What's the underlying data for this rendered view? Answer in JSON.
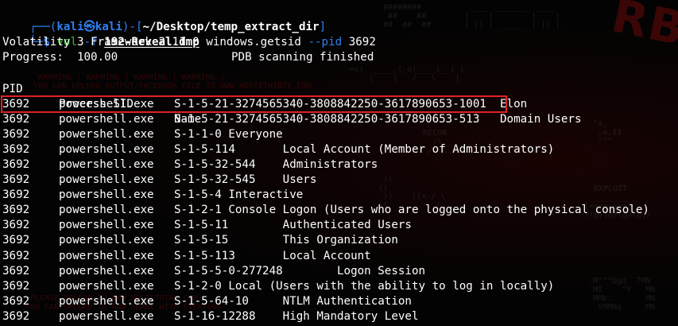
{
  "prompt": {
    "frame_top": "┌──(",
    "user": "kali㉿kali",
    "frame_mid": ")-[",
    "path": "~/Desktop/temp_extract_dir",
    "frame_end": "]",
    "frame_bottom": "└─",
    "sign": "$"
  },
  "command": {
    "name": "vol",
    "flag_f": "-f",
    "file": "192-Reveal.dmp",
    "plugin": "windows.getsid",
    "flag_pid": "--pid",
    "pid": "3692"
  },
  "output": {
    "banner": "Volatility 3 Framework 2.11.0",
    "progress": "Progress:  100.00\t\t       PDB scanning finished",
    "headers": {
      "pid": "PID",
      "process": "Process",
      "sid": "SID",
      "name": "Name"
    },
    "rows": [
      {
        "pid": "3692",
        "process": "powershell.exe",
        "rest": "S-1-5-21-3274565340-3808842250-3617890653-1001  Elon"
      },
      {
        "pid": "3692",
        "process": "powershell.exe",
        "rest": "S-1-5-21-3274565340-3808842250-3617890653-513   Domain Users"
      },
      {
        "pid": "3692",
        "process": "powershell.exe",
        "rest": "S-1-1-0 Everyone"
      },
      {
        "pid": "3692",
        "process": "powershell.exe",
        "rest": "S-1-5-114       Local Account (Member of Administrators)"
      },
      {
        "pid": "3692",
        "process": "powershell.exe",
        "rest": "S-1-5-32-544    Administrators"
      },
      {
        "pid": "3692",
        "process": "powershell.exe",
        "rest": "S-1-5-32-545    Users"
      },
      {
        "pid": "3692",
        "process": "powershell.exe",
        "rest": "S-1-5-4 Interactive"
      },
      {
        "pid": "3692",
        "process": "powershell.exe",
        "rest": "S-1-2-1 Console Logon (Users who are logged onto the physical console)"
      },
      {
        "pid": "3692",
        "process": "powershell.exe",
        "rest": "S-1-5-11        Authenticated Users"
      },
      {
        "pid": "3692",
        "process": "powershell.exe",
        "rest": "S-1-5-15        This Organization"
      },
      {
        "pid": "3692",
        "process": "powershell.exe",
        "rest": "S-1-5-113       Local Account"
      },
      {
        "pid": "3692",
        "process": "powershell.exe",
        "rest": "S-1-5-5-0-277248        Logon Session"
      },
      {
        "pid": "3692",
        "process": "powershell.exe",
        "rest": "S-1-2-0 Local (Users with the ability to log in locally)"
      },
      {
        "pid": "3692",
        "process": "powershell.exe",
        "rest": "S-1-5-64-10     NTLM Authentication"
      },
      {
        "pid": "3692",
        "process": "powershell.exe",
        "rest": "S-1-16-12288    High Mandatory Level"
      }
    ]
  },
  "highlight_color": "#e02020",
  "background_color": "#030303",
  "prompt_color": "#2f7ff0"
}
